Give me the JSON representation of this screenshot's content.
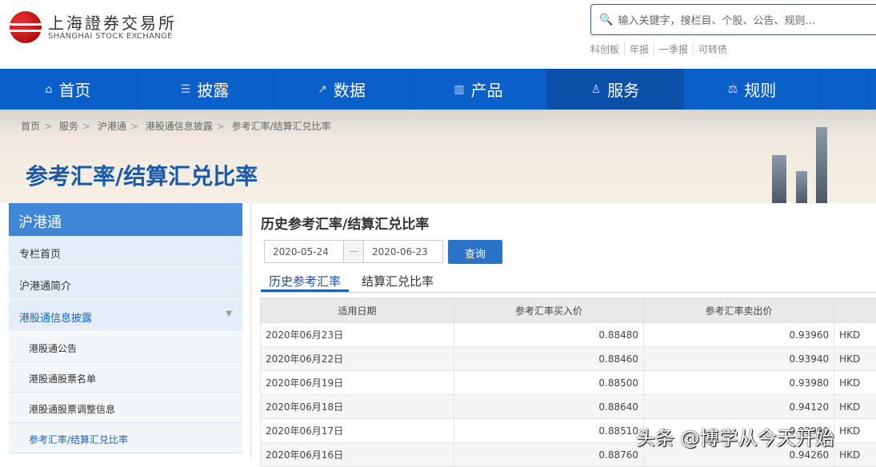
{
  "logo": {
    "cn": "上海證券交易所",
    "en": "SHANGHAI STOCK EXCHANGE"
  },
  "search": {
    "placeholder": "输入关键字，搜栏目、个股、公告、规则..."
  },
  "hot_links": [
    "科创板",
    "年报",
    "一季报",
    "可转债"
  ],
  "nav": [
    {
      "label": "首页",
      "icon": "home-icon"
    },
    {
      "label": "披露",
      "icon": "document-icon"
    },
    {
      "label": "数据",
      "icon": "chart-icon"
    },
    {
      "label": "产品",
      "icon": "bar-chart-icon"
    },
    {
      "label": "服务",
      "icon": "user-icon"
    },
    {
      "label": "规则",
      "icon": "scale-icon"
    }
  ],
  "breadcrumb": [
    "首页",
    "服务",
    "沪港通",
    "港股通信息披露",
    "参考汇率/结算汇兑比率"
  ],
  "page_title": "参考汇率/结算汇兑比率",
  "sidebar": {
    "title": "沪港通",
    "items": [
      "专栏首页",
      "沪港通简介",
      "港股通信息披露"
    ],
    "subitems": [
      "港股通公告",
      "港股通股票名单",
      "港股通股票调整信息",
      "参考汇率/结算汇兑比率"
    ]
  },
  "main": {
    "title": "历史参考汇率/结算汇兑比率",
    "start_date": "2020-05-24",
    "end_date": "2020-06-23",
    "query": "查询",
    "tabs": [
      "历史参考汇率",
      "结算汇兑比率"
    ],
    "columns": [
      "适用日期",
      "参考汇率买入价",
      "参考汇率卖出价",
      ""
    ],
    "rows": [
      [
        "2020年06月23日",
        "0.88480",
        "0.93960",
        "HKD"
      ],
      [
        "2020年06月22日",
        "0.88460",
        "0.93940",
        "HKD"
      ],
      [
        "2020年06月19日",
        "0.88500",
        "0.93980",
        "HKD"
      ],
      [
        "2020年06月18日",
        "0.88640",
        "0.94120",
        "HKD"
      ],
      [
        "2020年06月17日",
        "0.88510",
        "0.93990",
        "HKD"
      ],
      [
        "2020年06月16日",
        "0.88760",
        "0.94260",
        "HKD"
      ]
    ]
  },
  "watermark": "头条 @博学从今天开始"
}
